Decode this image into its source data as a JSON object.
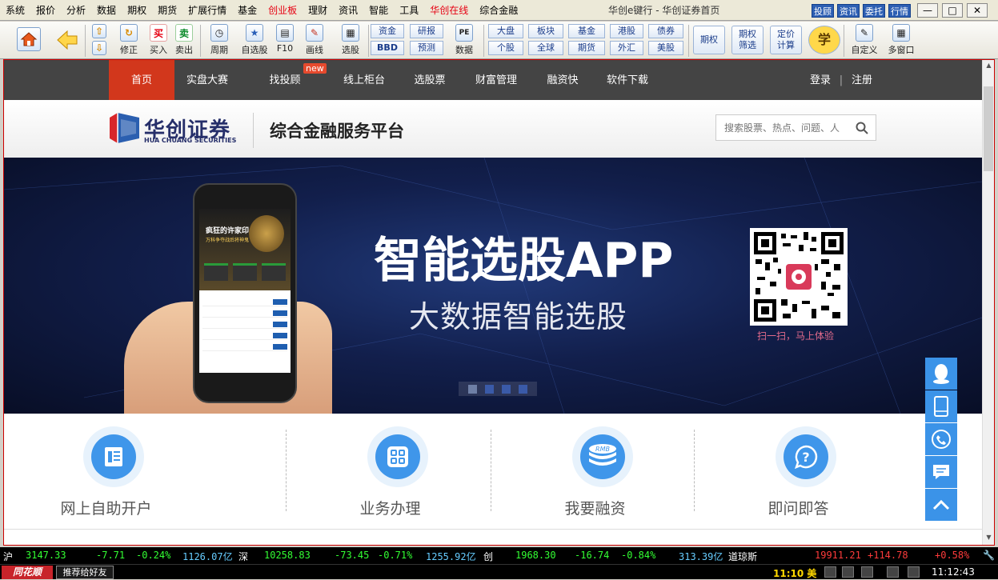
{
  "menu": {
    "items": [
      "系统",
      "报价",
      "分析",
      "数据",
      "期权",
      "期货",
      "扩展行情",
      "基金",
      "创业板",
      "理财",
      "资讯",
      "智能",
      "工具",
      "华创在线",
      "综合金融"
    ],
    "red_items": [
      "创业板",
      "华创在线"
    ]
  },
  "window": {
    "title": "华创e键行 - 华创证券首页",
    "top_buttons": [
      "投顾",
      "资讯",
      "委托",
      "行情"
    ],
    "controls": {
      "minimize": "—",
      "maximize": "□",
      "close": "✕"
    }
  },
  "toolbar": {
    "buy_glyph": "买",
    "sell_glyph": "卖",
    "labels": {
      "modify": "修正",
      "buy": "买入",
      "sell": "卖出",
      "period": "周期",
      "selfpick": "自选股",
      "f10": "F10",
      "drawline": "画线",
      "select": "选股",
      "data": "数据",
      "custom": "自定义",
      "multiwindow": "多窗口"
    },
    "small_buttons": {
      "fund": "资金",
      "bbd": "BBD",
      "research": "研报",
      "forecast": "预测",
      "pe": "PE",
      "market": "大盘",
      "single": "个股",
      "sector": "板块",
      "global": "全球",
      "fundx": "基金",
      "futures": "期货",
      "hk": "港股",
      "forex": "外汇",
      "bond": "债券",
      "us": "美股"
    },
    "big_buttons": {
      "options": "期权",
      "option_screen": "期权\n筛选",
      "pricing": "定价\n计算",
      "learn": "学"
    }
  },
  "web": {
    "nav": {
      "items": [
        "首页",
        "实盘大赛",
        "找投顾",
        "线上柜台",
        "选股票",
        "财富管理",
        "融资快",
        "软件下载"
      ],
      "active": "首页",
      "new_badge": "new",
      "login": "登录",
      "separator": "|",
      "register": "注册"
    },
    "logo": {
      "name": "华创证券",
      "en": "HUA CHUANG SECURITIES"
    },
    "slogan": "综合金融服务平台",
    "search": {
      "placeholder": "搜索股票、热点、问题、人"
    },
    "banner": {
      "headline": "智能选股APP",
      "subline": "大数据智能选股",
      "qr_caption": "扫一扫，马上体验",
      "phone_title": "疯狂的许家印",
      "phone_subtitle": "万科争夺战后将神鬼"
    },
    "services": [
      {
        "label": "网上自助开户",
        "icon": "form-icon"
      },
      {
        "label": "业务办理",
        "icon": "grid-icon"
      },
      {
        "label": "我要融资",
        "icon": "coin-stack-icon",
        "icon_text": "RMB"
      },
      {
        "label": "即问即答",
        "icon": "question-icon"
      }
    ],
    "float_icons": [
      "qq-icon",
      "phone-icon",
      "call-icon",
      "chat-icon",
      "up-arrow-icon"
    ]
  },
  "ticker": {
    "sh": {
      "name": "沪",
      "index": "3147.33",
      "change": "-7.71",
      "pct": "-0.24%",
      "amount": "1126.07亿"
    },
    "sz": {
      "name": "深",
      "index": "10258.83",
      "change": "-73.45",
      "pct": "-0.71%",
      "amount": "1255.92亿"
    },
    "cy": {
      "name": "创",
      "index": "1968.30",
      "change": "-16.74",
      "pct": "-0.84%",
      "amount": "313.39亿"
    },
    "dj": {
      "name": "道琼斯",
      "index": "19911.21",
      "change": "+114.78",
      "pct": "+0.58%"
    }
  },
  "status": {
    "brand": "同花顺",
    "recommend": "推荐给好友",
    "news_time": "11:10 美",
    "clock": "11:12:43"
  },
  "colors": {
    "accent_red": "#d2371c",
    "nav_bg": "#444444",
    "brand_navy": "#262f6a",
    "service_blue": "#3f96ea",
    "ticker_up": "#ff3b3b",
    "ticker_down": "#33ff33",
    "ticker_amount": "#66ccff"
  }
}
